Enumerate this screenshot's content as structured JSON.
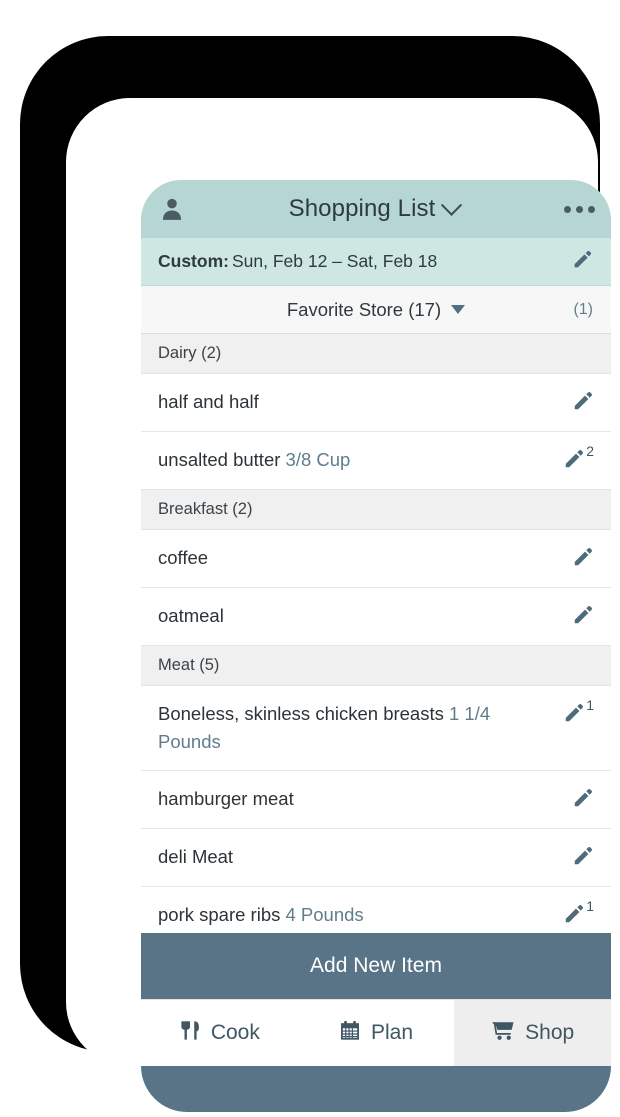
{
  "app": {
    "header": {
      "avatar_icon": "person-icon",
      "title": "Shopping List",
      "title_chevron_icon": "chevron-down-icon",
      "overflow_icon": "more-dots-icon",
      "bg_color": "#b5d6d2"
    },
    "date_bar": {
      "label": "Custom:",
      "range": "Sun, Feb 12 – Sat, Feb 18",
      "edit_icon": "pencil-icon",
      "bg_color": "#cfe7e3"
    },
    "store_bar": {
      "store_name": "Favorite Store (17)",
      "caret_icon": "caret-down-icon",
      "right_count": "(1)"
    }
  },
  "sections": [
    {
      "title": "Dairy (2)",
      "items": [
        {
          "name": "half and half",
          "qty": "",
          "badge": "",
          "edit_icon": "pencil-icon"
        },
        {
          "name": "unsalted butter",
          "qty": "3/8 Cup",
          "badge": "2",
          "edit_icon": "pencil-icon"
        }
      ]
    },
    {
      "title": "Breakfast (2)",
      "items": [
        {
          "name": "coffee",
          "qty": "",
          "badge": "",
          "edit_icon": "pencil-icon"
        },
        {
          "name": "oatmeal",
          "qty": "",
          "badge": "",
          "edit_icon": "pencil-icon"
        }
      ]
    },
    {
      "title": "Meat (5)",
      "items": [
        {
          "name": "Boneless, skinless chicken breasts",
          "qty": "1 1/4 Pounds",
          "badge": "1",
          "edit_icon": "pencil-icon"
        },
        {
          "name": "hamburger meat",
          "qty": "",
          "badge": "",
          "edit_icon": "pencil-icon"
        },
        {
          "name": "deli Meat",
          "qty": "",
          "badge": "",
          "edit_icon": "pencil-icon"
        },
        {
          "name": "pork spare ribs",
          "qty": "4 Pounds",
          "badge": "1",
          "edit_icon": "pencil-icon"
        }
      ]
    }
  ],
  "add_button": {
    "label": "Add New Item",
    "bg_color": "#587486"
  },
  "tabs": [
    {
      "label": "Cook",
      "icon": "fork-knife-icon",
      "active": false
    },
    {
      "label": "Plan",
      "icon": "calendar-icon",
      "active": false
    },
    {
      "label": "Shop",
      "icon": "shopping-cart-icon",
      "active": true
    }
  ],
  "colors": {
    "accent_teal": "#b5d6d2",
    "accent_teal_light": "#cfe7e3",
    "slate": "#587486",
    "qty_text": "#5f7d8c"
  }
}
